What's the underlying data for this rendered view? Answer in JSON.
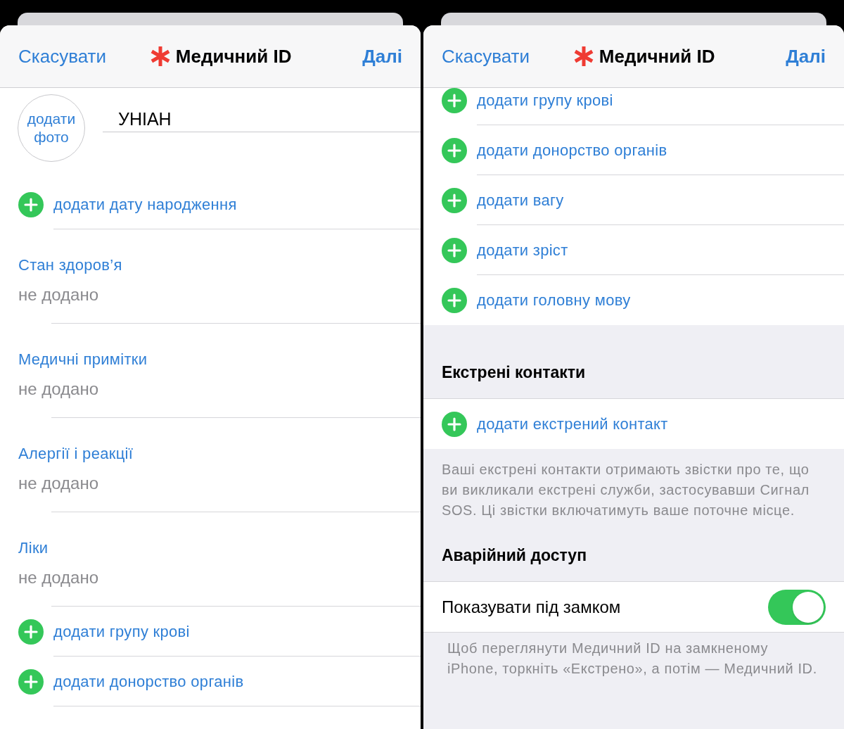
{
  "panels": [
    {
      "nav": {
        "cancel": "Скасувати",
        "title": "Медичний ID",
        "next": "Далі"
      },
      "profile": {
        "photo_button": "додати фото",
        "name": "УНІАН"
      },
      "items": [
        {
          "kind": "add",
          "label": "додати дату народження"
        },
        {
          "kind": "field",
          "label": "Стан здоров’я",
          "value": "не додано"
        },
        {
          "kind": "field",
          "label": "Медичні примітки",
          "value": "не додано"
        },
        {
          "kind": "field",
          "label": "Алергії і реакції",
          "value": "не додано"
        },
        {
          "kind": "field",
          "label": "Ліки",
          "value": "не додано"
        },
        {
          "kind": "add",
          "label": "додати групу крові"
        },
        {
          "kind": "add",
          "label": "додати донорство органів"
        }
      ]
    },
    {
      "nav": {
        "cancel": "Скасувати",
        "title": "Медичний ID",
        "next": "Далі"
      },
      "items": [
        {
          "kind": "add",
          "label": "додати групу крові"
        },
        {
          "kind": "add",
          "label": "додати донорство органів"
        },
        {
          "kind": "add",
          "label": "додати вагу"
        },
        {
          "kind": "add",
          "label": "додати зріст"
        },
        {
          "kind": "add",
          "label": "додати головну мову",
          "last": true
        },
        {
          "kind": "header",
          "label": "Екстрені контакти"
        },
        {
          "kind": "add",
          "label": "додати екстрений контакт",
          "last": true
        },
        {
          "kind": "footnote",
          "label": "Ваші екстрені контакти отримають звістки про те, що ви викликали екстрені служби, застосувавши Сигнал SOS. Ці звістки включатимуть ваше поточне місце."
        },
        {
          "kind": "header",
          "label": "Аварійний доступ"
        },
        {
          "kind": "toggle",
          "label": "Показувати під замком",
          "on": true
        },
        {
          "kind": "footnote",
          "label": "Щоб переглянути Медичний ID на замкненому iPhone, торкніть «Екстрено», а потім — Медичний ID."
        }
      ]
    }
  ]
}
